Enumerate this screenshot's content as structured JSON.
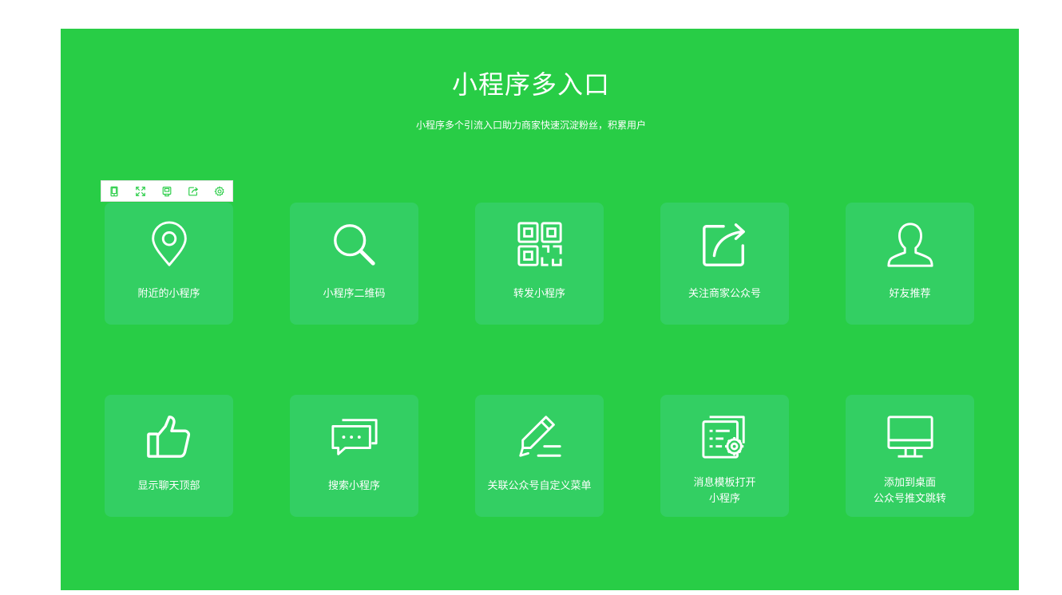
{
  "header": {
    "title": "小程序多入口",
    "subtitle": "小程序多个引流入口助力商家快速沉淀粉丝，积累用户"
  },
  "toolbar": {
    "icons": [
      "phone-icon",
      "expand-icon",
      "save-icon",
      "share-icon",
      "settings-icon"
    ]
  },
  "colors": {
    "panel": "#28cd46",
    "card": "#33cf63",
    "text": "#ffffff",
    "toolbar_icon": "#28cd46"
  },
  "cards": [
    {
      "icon": "location-pin-icon",
      "label": "附近的小程序"
    },
    {
      "icon": "search-icon",
      "label": "小程序二维码"
    },
    {
      "icon": "qr-code-icon",
      "label": "转发小程序"
    },
    {
      "icon": "share-arrow-icon",
      "label": "关注商家公众号"
    },
    {
      "icon": "user-icon",
      "label": "好友推荐"
    },
    {
      "icon": "thumbs-up-icon",
      "label": "显示聊天顶部"
    },
    {
      "icon": "chat-icon",
      "label": "搜索小程序"
    },
    {
      "icon": "pencil-icon",
      "label": "关联公众号自定义菜单"
    },
    {
      "icon": "message-template-icon",
      "label_line1": "消息模板打开",
      "label_line2": "小程序"
    },
    {
      "icon": "desktop-icon",
      "label_line1": "添加到桌面",
      "label_line2": "公众号推文跳转"
    }
  ]
}
